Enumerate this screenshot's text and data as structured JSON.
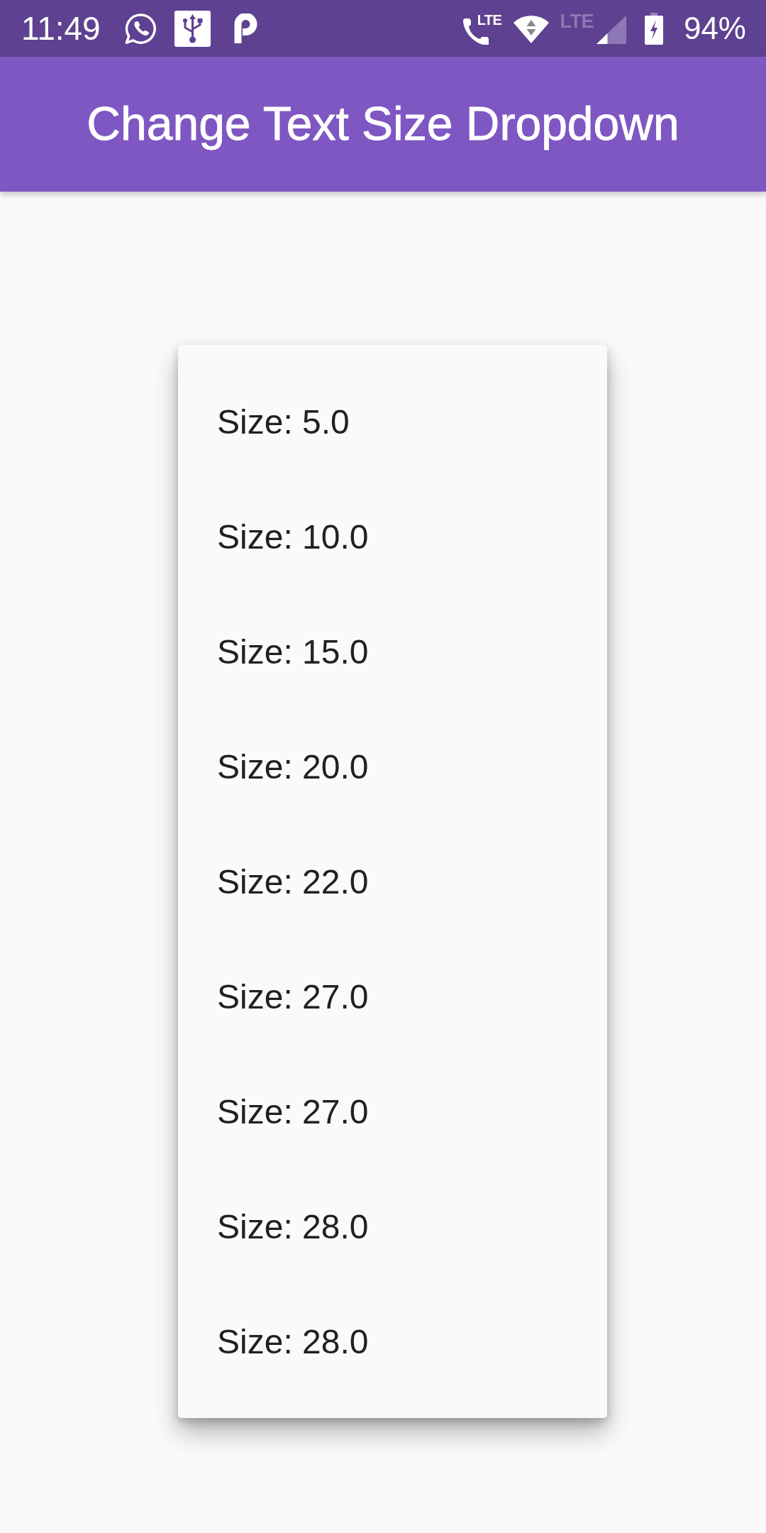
{
  "status_bar": {
    "time": "11:49",
    "call_label": "LTE",
    "network_label": "LTE",
    "battery": "94%"
  },
  "app_bar": {
    "title": "Change Text Size Dropdown"
  },
  "dropdown_menu": {
    "items": [
      {
        "label": "Size: 5.0"
      },
      {
        "label": "Size: 10.0"
      },
      {
        "label": "Size: 15.0"
      },
      {
        "label": "Size: 20.0"
      },
      {
        "label": "Size: 22.0"
      },
      {
        "label": "Size: 27.0"
      },
      {
        "label": "Size: 27.0"
      },
      {
        "label": "Size: 28.0"
      },
      {
        "label": "Size: 28.0"
      }
    ]
  }
}
